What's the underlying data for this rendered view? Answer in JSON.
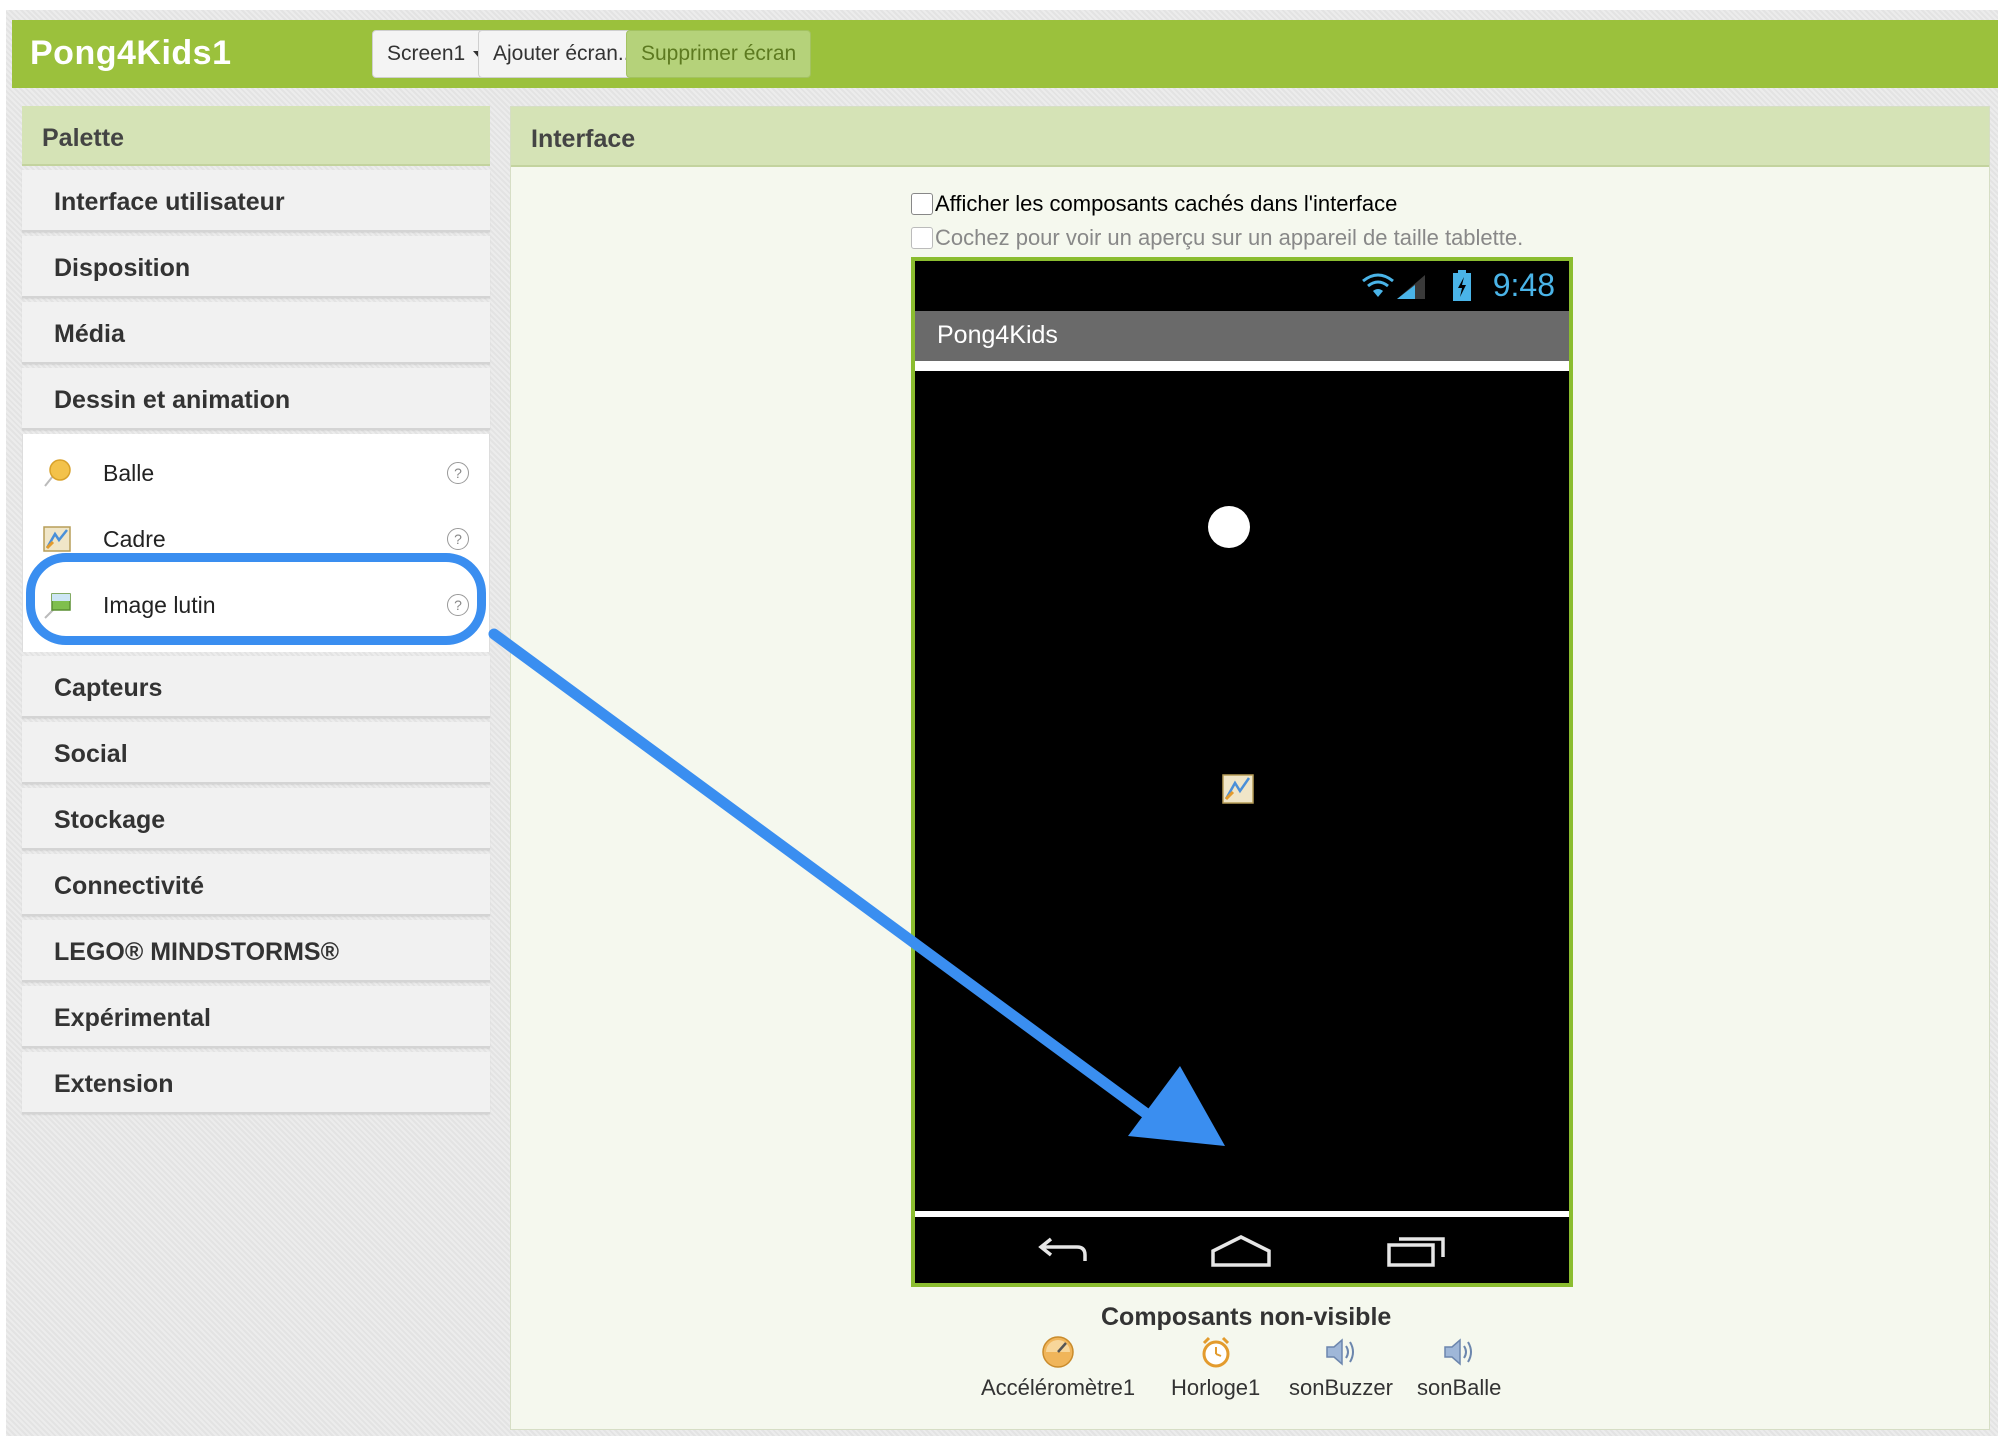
{
  "header": {
    "app_title": "Pong4Kids1",
    "screen_select": "Screen1",
    "add_screen": "Ajouter écran...",
    "remove_screen": "Supprimer écran"
  },
  "palette": {
    "title": "Palette",
    "categories_top": [
      "Interface utilisateur",
      "Disposition",
      "Média",
      "Dessin et animation"
    ],
    "open_category_items": [
      {
        "label": "Balle",
        "icon": "ball-icon"
      },
      {
        "label": "Cadre",
        "icon": "canvas-icon"
      },
      {
        "label": "Image lutin",
        "icon": "image-sprite-icon"
      }
    ],
    "categories_bottom": [
      "Capteurs",
      "Social",
      "Stockage",
      "Connectivité",
      "LEGO® MINDSTORMS®",
      "Expérimental",
      "Extension"
    ]
  },
  "viewer": {
    "title": "Interface",
    "show_hidden_label": "Afficher les composants cachés dans l'interface",
    "tablet_preview_label": "Cochez pour voir un aperçu sur un appareil de taille tablette.",
    "phone": {
      "time": "9:48",
      "app_bar_title": "Pong4Kids"
    },
    "non_visible_title": "Composants non-visible",
    "non_visible_components": [
      "Accéléromètre1",
      "Horloge1",
      "sonBuzzer",
      "sonBalle"
    ]
  },
  "colors": {
    "brand_green": "#9bc13c",
    "header_tint": "#d5e3b6",
    "annotation_blue": "#3a8ef0",
    "phone_border": "#8bbd2f"
  }
}
